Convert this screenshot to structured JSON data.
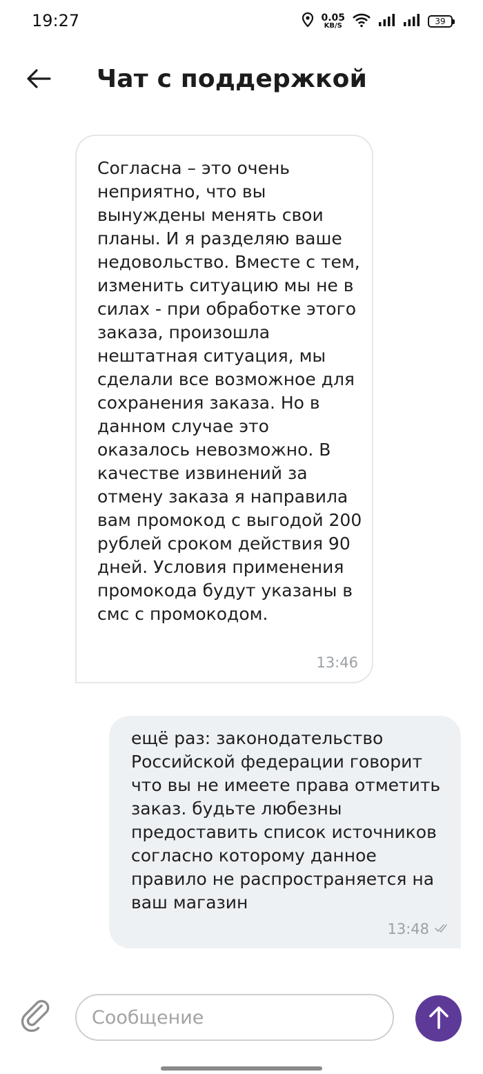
{
  "status_bar": {
    "time": "19:27",
    "net_speed_value": "0.05",
    "net_speed_unit": "KB/S",
    "battery": "39",
    "icons": [
      "location-icon",
      "wifi-icon",
      "signal-icon",
      "signal-icon",
      "battery-icon"
    ]
  },
  "header": {
    "title": "Чат с поддержкой",
    "back_icon": "arrow-left-icon"
  },
  "messages": [
    {
      "direction": "incoming",
      "text": "Согласна – это очень неприятно, что вы вынуждены менять свои планы. И я разделяю ваше недовольство. Вместе с тем, изменить ситуацию мы не в силах -  при обработке этого заказа, произошла нештатная ситуация, мы сделали все возможное для сохранения заказа. Но в данном случае это оказалось невозможно. В качестве извинений за отмену заказа я направила вам промокод с выгодой 200 рублей сроком действия 90 дней. Условия применения промокода будут указаны в смс с промокодом.",
      "time": "13:46"
    },
    {
      "direction": "outgoing",
      "text": "ещё раз: законодательство Российской федерации говорит что вы не имеете права отметить заказ. будьте любезны предоставить список источников согласно которому данное правило не распространяется на ваш магазин",
      "time": "13:48",
      "status_icon": "check-icon"
    }
  ],
  "composer": {
    "placeholder": "Сообщение",
    "value": "",
    "attach_icon": "paperclip-icon",
    "send_icon": "arrow-up-icon",
    "send_color": "#5e3a98"
  }
}
